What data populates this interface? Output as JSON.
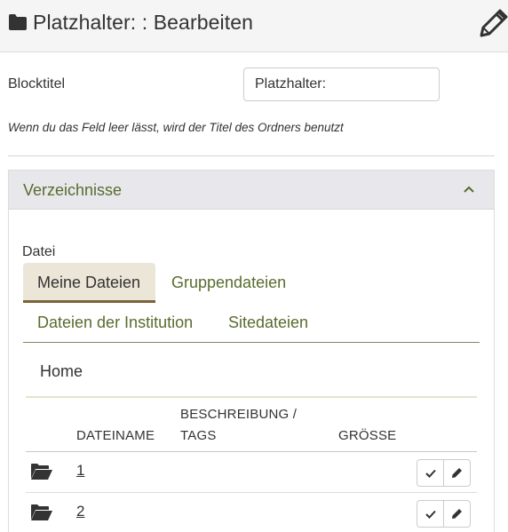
{
  "header": {
    "title": "Platzhalter: : Bearbeiten",
    "icon": "folder-icon",
    "edit_icon": "pencil-icon"
  },
  "form": {
    "blocktitle_label": "Blocktitel",
    "blocktitle_value": "Platzhalter:",
    "hint": "Wenn du das Feld leer lässt, wird der Titel des Ordners benutzt"
  },
  "panel": {
    "title": "Verzeichnisse",
    "toggle_icon": "chevron-up-icon",
    "file_label": "Datei",
    "tabs": [
      {
        "label": "Meine Dateien",
        "active": true
      },
      {
        "label": "Gruppendateien",
        "active": false
      },
      {
        "label": "Dateien der Institution",
        "active": false
      },
      {
        "label": "Sitedateien",
        "active": false
      }
    ],
    "breadcrumb": "Home",
    "columns": {
      "name": "DATEINAME",
      "description_line1": "BESCHREIBUNG /",
      "description_line2": "TAGS",
      "size": "GRÖSSE"
    },
    "rows": [
      {
        "icon": "folder-open-icon",
        "name": "1",
        "select_icon": "check-icon",
        "edit_icon": "pencil-icon"
      },
      {
        "icon": "folder-open-icon",
        "name": "2",
        "select_icon": "check-icon",
        "edit_icon": "pencil-icon"
      }
    ]
  },
  "colors": {
    "accent_green": "#586c2e",
    "active_tab_bg": "#ece6d8",
    "active_tab_border": "#7a6336",
    "panel_header_bg": "#e8e8ec"
  }
}
